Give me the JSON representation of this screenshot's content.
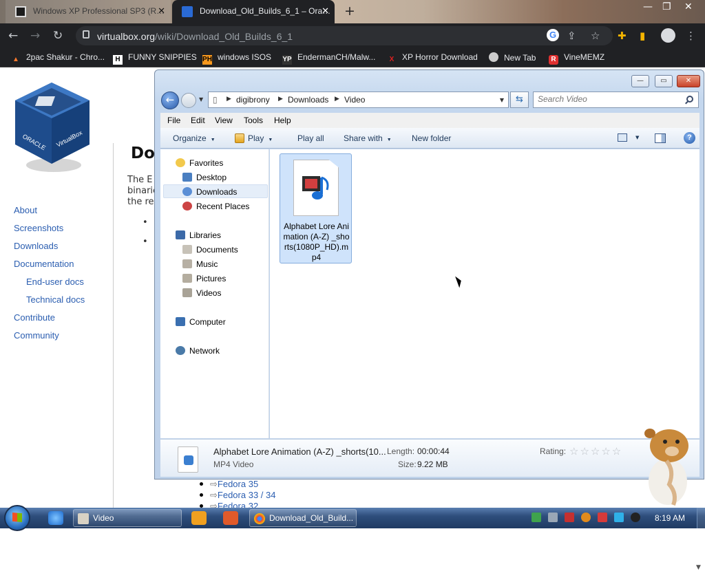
{
  "browser": {
    "tabs": [
      {
        "title": "Windows XP Professional SP3 (R…",
        "active": false
      },
      {
        "title": "Download_Old_Builds_6_1 – Ora…",
        "active": true
      }
    ],
    "url_domain": "virtualbox.org",
    "url_path": "/wiki/Download_Old_Builds_6_1",
    "bookmarks": [
      {
        "label": "2pac Shakur - Chro...",
        "icon": "fire-icon",
        "color": "#ff7a2e"
      },
      {
        "label": "FUNNY SNIPPIES",
        "icon": "H",
        "color": "#ffffff"
      },
      {
        "label": "windows ISOS",
        "icon": "PH",
        "color": "#f7971d"
      },
      {
        "label": "EndermanCH/Malw...",
        "icon": "YP",
        "color": "#ffffff"
      },
      {
        "label": "XP Horror Download",
        "icon": "X",
        "color": "#e02020"
      },
      {
        "label": "New Tab",
        "icon": "chrome-icon",
        "color": "#cccccc"
      },
      {
        "label": "VineMEMZ",
        "icon": "R",
        "color": "#e03030"
      }
    ]
  },
  "page": {
    "heading": "Do",
    "para_lines": [
      "The E",
      "binarie",
      "the re"
    ],
    "nav": [
      {
        "label": "About",
        "sub": false
      },
      {
        "label": "Screenshots",
        "sub": false
      },
      {
        "label": "Downloads",
        "sub": false
      },
      {
        "label": "Documentation",
        "sub": false
      },
      {
        "label": "End-user docs",
        "sub": true
      },
      {
        "label": "Technical docs",
        "sub": true
      },
      {
        "label": "Contribute",
        "sub": false
      },
      {
        "label": "Community",
        "sub": false
      }
    ],
    "links": [
      "Fedora 35",
      "Fedora 33 / 34",
      "Fedora 32"
    ]
  },
  "explorer": {
    "breadcrumb": [
      "digibrony",
      "Downloads",
      "Video"
    ],
    "search_placeholder": "Search Video",
    "menu": [
      "File",
      "Edit",
      "View",
      "Tools",
      "Help"
    ],
    "commands": {
      "organize": "Organize",
      "play": "Play",
      "play_all": "Play all",
      "share": "Share with",
      "new_folder": "New folder"
    },
    "nav": {
      "favorites": "Favorites",
      "favorites_items": [
        "Desktop",
        "Downloads",
        "Recent Places"
      ],
      "selected": "Downloads",
      "libraries": "Libraries",
      "libraries_items": [
        "Documents",
        "Music",
        "Pictures",
        "Videos"
      ],
      "computer": "Computer",
      "network": "Network"
    },
    "file": {
      "name": "Alphabet Lore Animation (A-Z) _shorts(1080P_HD).mp4"
    },
    "details": {
      "name": "Alphabet Lore Animation (A-Z) _shorts(10...",
      "type": "MP4 Video",
      "length_label": "Length:",
      "length": "00:00:44",
      "size_label": "Size:",
      "size": "9.22 MB",
      "rating_label": "Rating:",
      "rating": 0,
      "rating_max": 5
    }
  },
  "taskbar": {
    "tasks": [
      {
        "label": "Video",
        "active": true
      },
      {
        "label": "Download_Old_Build...",
        "active": false
      }
    ],
    "time": "8:19 AM"
  }
}
